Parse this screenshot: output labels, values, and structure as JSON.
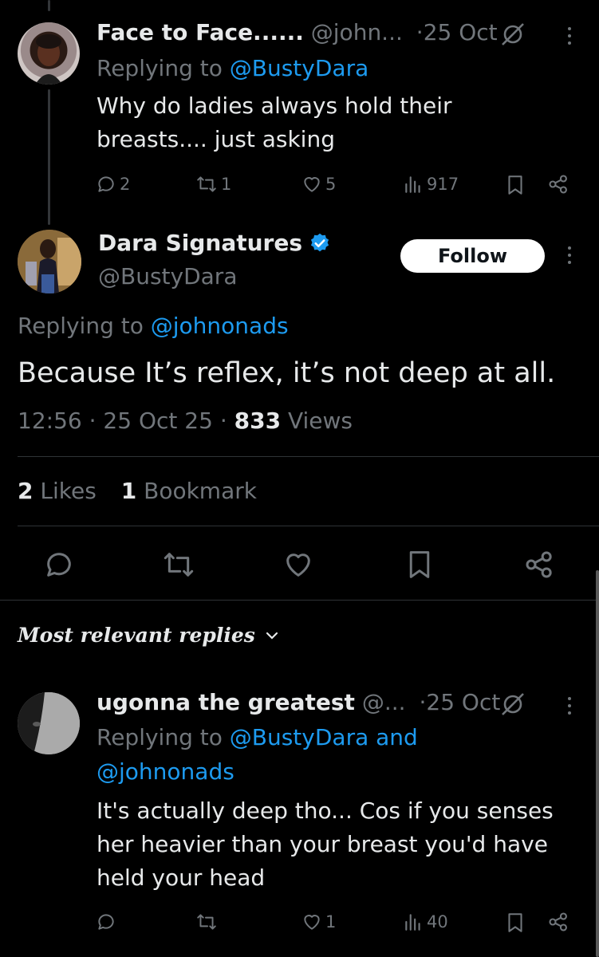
{
  "reply1": {
    "display_name": "Face to Face......",
    "handle": "@john...",
    "sep": "·",
    "date": "25 Oct",
    "replying_prefix": "Replying to",
    "replying_to": "@BustyDara",
    "text_line1": "Why do ladies always hold their",
    "text_line2": "breasts.... just asking",
    "replies": "2",
    "reposts": "1",
    "likes": "5",
    "views": "917"
  },
  "main_tweet": {
    "display_name": "Dara Signatures",
    "handle": "@BustyDara",
    "follow_label": "Follow",
    "replying_prefix": "Replying to",
    "replying_to": "@johnonads",
    "text": "Because It’s reflex, it’s not deep at all.",
    "time": "12:56",
    "date": "25 Oct 25",
    "views_count": "833",
    "views_label": "Views",
    "likes_count": "2",
    "likes_label": "Likes",
    "bookmarks_count": "1",
    "bookmarks_label": "Bookmark"
  },
  "sort_label": "Most relevant replies",
  "reply2": {
    "display_name": "ugonna the greatest",
    "handle": "@...",
    "sep": "·",
    "date": "25 Oct",
    "replying_prefix": "Replying to",
    "replying_to_1": "@BustyDara and",
    "replying_to_2": "@johnonads",
    "text_line1": "It's actually deep tho... Cos if you senses",
    "text_line2": "her heavier than your breast you'd have",
    "text_line3": "held your head",
    "likes": "1",
    "views": "40"
  },
  "colors": {
    "background": "#000000",
    "text": "#e7e9ea",
    "muted": "#71767b",
    "accent": "#1d9bf0",
    "verified": "#1d9bf0"
  },
  "icons": [
    "reply-icon",
    "repost-icon",
    "like-icon",
    "views-icon",
    "bookmark-icon",
    "share-icon",
    "more-icon",
    "verified-badge-icon",
    "grok-icon",
    "chevron-down-icon"
  ]
}
